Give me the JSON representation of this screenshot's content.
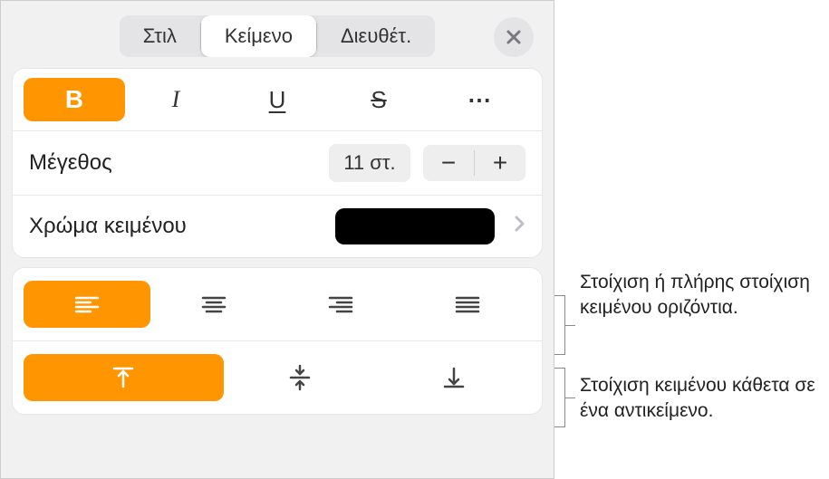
{
  "tabs": {
    "style": "Στιλ",
    "text": "Κείμενο",
    "arrange": "Διευθέτ."
  },
  "format": {
    "bold": "B",
    "italic": "I",
    "underline": "U",
    "strike": "S",
    "more": "⋯"
  },
  "size": {
    "label": "Μέγεθος",
    "value": "11 στ.",
    "minus": "−",
    "plus": "+"
  },
  "textcolor": {
    "label": "Χρώμα κειμένου",
    "color": "#000000"
  },
  "callouts": {
    "horizontal": "Στοίχιση ή πλήρης στοίχιση κειμένου οριζόντια.",
    "vertical": "Στοίχιση κειμένου κάθετα σε ένα αντικείμενο."
  }
}
